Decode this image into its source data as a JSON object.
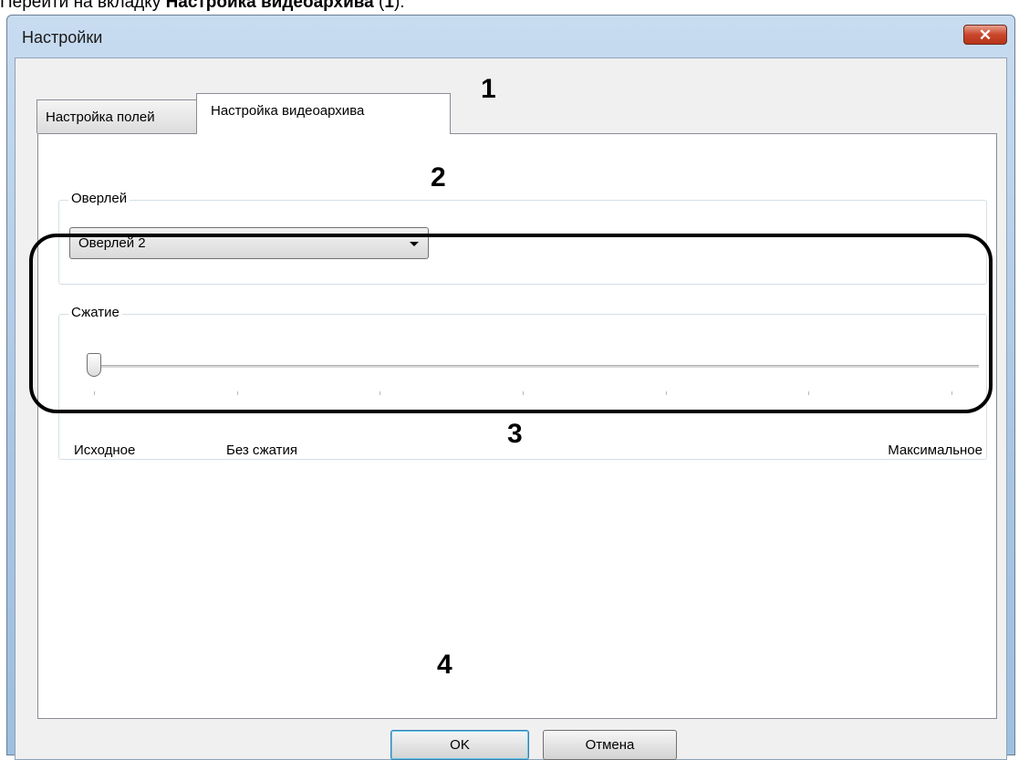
{
  "intro": {
    "prefix": "Перейти на вкладку ",
    "bold": "Настройка видеоархива",
    "suffix_open": " (",
    "number": "1",
    "suffix_close": ")."
  },
  "window": {
    "title": "Настройки",
    "close_glyph": "✕"
  },
  "tabs": [
    {
      "label": "Настройка полей",
      "selected": false
    },
    {
      "label": "Настройка видеоархива",
      "selected": true
    }
  ],
  "overlay": {
    "legend": "Оверлей",
    "selected": "Оверлей 2"
  },
  "compression": {
    "legend": "Сжатие",
    "value": 0,
    "tick_count": 7,
    "labels": {
      "start": "Исходное",
      "second": "Без сжатия",
      "end": "Максимальное"
    }
  },
  "buttons": {
    "ok": "OK",
    "cancel": "Отмена"
  },
  "annotations": [
    "1",
    "2",
    "3",
    "4"
  ]
}
